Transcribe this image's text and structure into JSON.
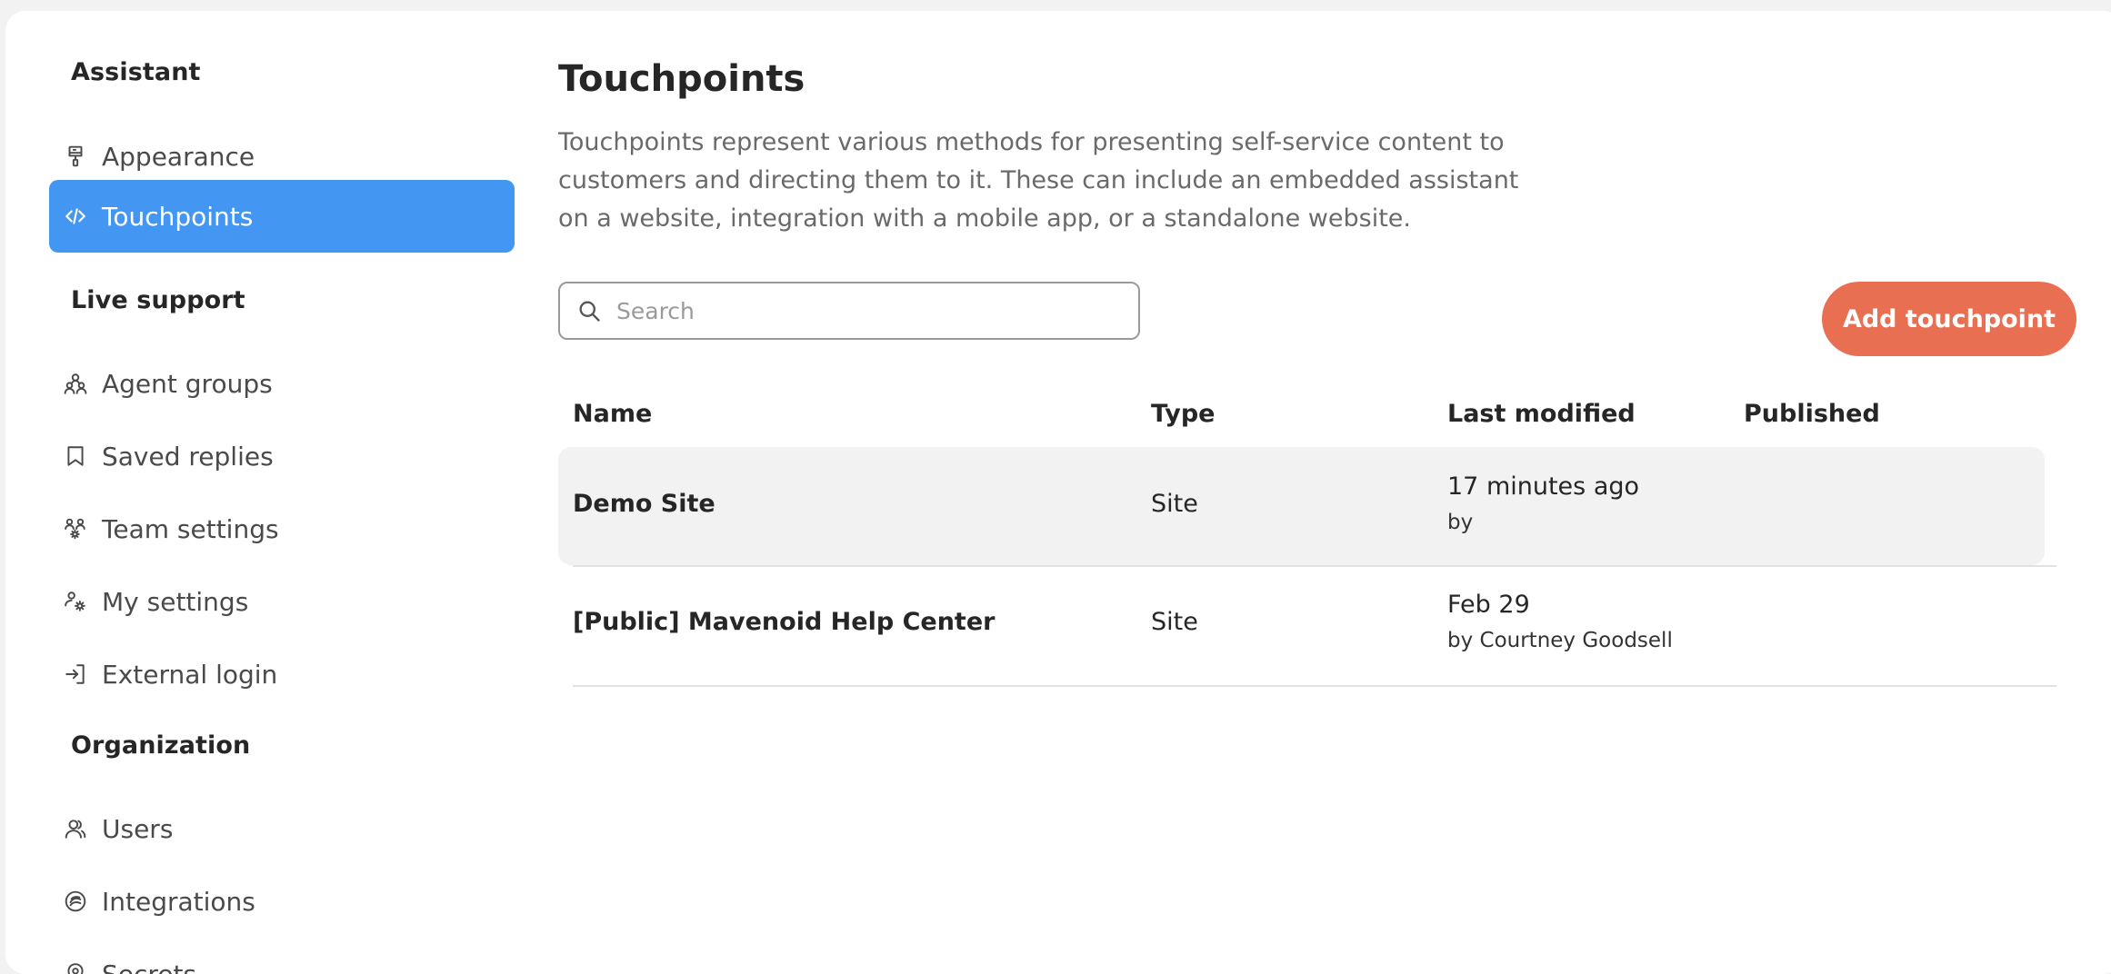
{
  "sidebar": {
    "sections": [
      {
        "title": "Assistant",
        "items": [
          {
            "label": "Appearance",
            "icon": "paintbrush-icon"
          },
          {
            "label": "Touchpoints",
            "icon": "code-icon",
            "active": true
          }
        ]
      },
      {
        "title": "Live support",
        "items": [
          {
            "label": "Agent groups",
            "icon": "agent-group-icon"
          },
          {
            "label": "Saved replies",
            "icon": "bookmark-icon"
          },
          {
            "label": "Team settings",
            "icon": "team-gear-icon"
          },
          {
            "label": "My settings",
            "icon": "user-gear-icon"
          },
          {
            "label": "External login",
            "icon": "login-icon"
          }
        ]
      },
      {
        "title": "Organization",
        "items": [
          {
            "label": "Users",
            "icon": "users-icon"
          },
          {
            "label": "Integrations",
            "icon": "integrations-icon"
          },
          {
            "label": "Secrets",
            "icon": "secrets-icon"
          }
        ]
      }
    ]
  },
  "main": {
    "title": "Touchpoints",
    "description": "Touchpoints represent various methods for presenting self-service content to customers and directing them to it. These can include an embedded assistant on a website, integration with a mobile app, or a standalone website.",
    "search": {
      "placeholder": "Search",
      "value": ""
    },
    "add_button_label": "Add touchpoint",
    "table": {
      "columns": [
        "Name",
        "Type",
        "Last modified",
        "Published"
      ],
      "rows": [
        {
          "name": "Demo Site",
          "type": "Site",
          "modified": "17 minutes ago",
          "modified_by": "by",
          "published": ""
        },
        {
          "name": "[Public] Mavenoid Help Center",
          "type": "Site",
          "modified": "Feb 29",
          "modified_by": "by Courtney Goodsell",
          "published": ""
        }
      ]
    }
  },
  "colors": {
    "accent": "#4496f3",
    "primary_button": "#e86f52",
    "row_hover": "#f2f2f2"
  }
}
